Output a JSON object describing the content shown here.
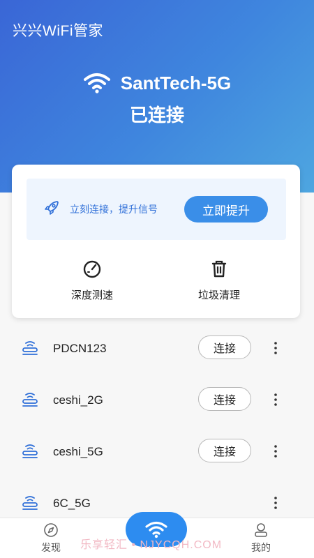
{
  "app": {
    "title": "兴兴WiFi管家"
  },
  "current": {
    "ssid": "SantTech-5G",
    "status": "已连接"
  },
  "card": {
    "boost_text": "立刻连接，提升信号",
    "boost_button": "立即提升",
    "tools": [
      {
        "label": "深度测速",
        "icon": "speedometer-icon"
      },
      {
        "label": "垃圾清理",
        "icon": "trash-icon"
      }
    ]
  },
  "networks": [
    {
      "name": "PDCN123",
      "action": "连接"
    },
    {
      "name": "ceshi_2G",
      "action": "连接"
    },
    {
      "name": "ceshi_5G",
      "action": "连接"
    },
    {
      "name": "6C_5G",
      "action": ""
    }
  ],
  "nav": {
    "discover": "发现",
    "mine": "我的",
    "center_icon": "wifi-icon"
  },
  "watermark": "乐享轻汇 • NJYCQH.COM",
  "colors": {
    "header_start": "#3a66d6",
    "header_end": "#4ea6e0",
    "accent": "#3a8ee8",
    "center_button": "#2d8cf0"
  }
}
